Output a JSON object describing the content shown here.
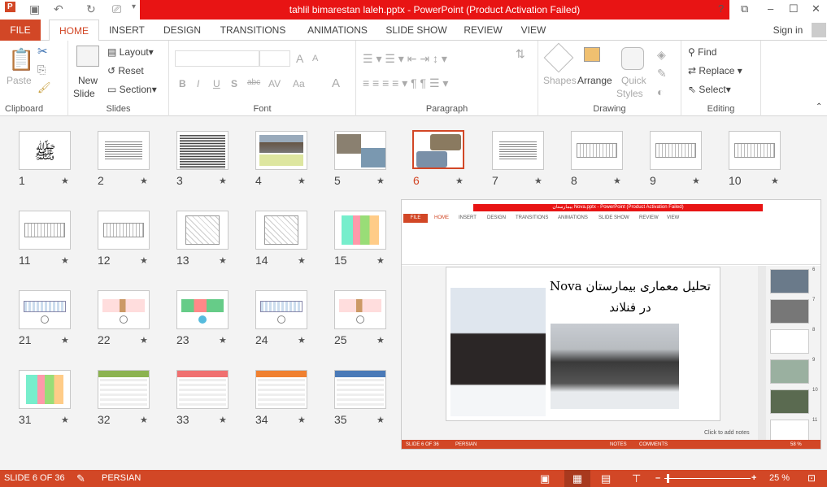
{
  "window": {
    "title": "tahlil bimarestan laleh.pptx -  PowerPoint (Product Activation Failed)",
    "help": "?",
    "restore_ribbon": "⧉",
    "minimize": "–",
    "maximize": "☐",
    "close": "✕"
  },
  "qat": {
    "app_icon": "powerpoint-icon",
    "save": "💾",
    "undo": "↶",
    "redo": "↻",
    "present": "⎚",
    "customize": "▾"
  },
  "tabs": [
    {
      "label": "FILE"
    },
    {
      "label": "HOME"
    },
    {
      "label": "INSERT"
    },
    {
      "label": "DESIGN"
    },
    {
      "label": "TRANSITIONS"
    },
    {
      "label": "ANIMATIONS"
    },
    {
      "label": "SLIDE SHOW"
    },
    {
      "label": "REVIEW"
    },
    {
      "label": "VIEW"
    }
  ],
  "sign_in": "Sign in",
  "ribbon": {
    "clipboard": {
      "label": "Clipboard",
      "paste": "Paste"
    },
    "slides": {
      "label": "Slides",
      "new_slide": "New",
      "new_slide2": "Slide",
      "layout": "Layout",
      "reset": "Reset",
      "section": "Section"
    },
    "font": {
      "label": "Font",
      "bold": "B",
      "italic": "I",
      "underline": "U",
      "shadow": "S",
      "strike": "abc",
      "spacing": "AV",
      "case": "Aa",
      "color": "A",
      "grow": "A",
      "shrink": "A"
    },
    "paragraph": {
      "label": "Paragraph"
    },
    "drawing": {
      "label": "Drawing",
      "shapes": "Shapes",
      "arrange": "Arrange",
      "quick_styles": "Quick",
      "quick_styles2": "Styles"
    },
    "editing": {
      "label": "Editing",
      "find": "Find",
      "replace": "Replace",
      "select": "Select"
    }
  },
  "slides": [
    {
      "n": "1",
      "kind": "calligraphy"
    },
    {
      "n": "2",
      "kind": "text"
    },
    {
      "n": "3",
      "kind": "densetext"
    },
    {
      "n": "4",
      "kind": "photo"
    },
    {
      "n": "5",
      "kind": "photos"
    },
    {
      "n": "6",
      "kind": "photos2",
      "selected": true
    },
    {
      "n": "7",
      "kind": "text"
    },
    {
      "n": "8",
      "kind": "drawing"
    },
    {
      "n": "9",
      "kind": "drawing"
    },
    {
      "n": "10",
      "kind": "drawing"
    },
    {
      "n": "11",
      "kind": "drawing"
    },
    {
      "n": "12",
      "kind": "drawing"
    },
    {
      "n": "13",
      "kind": "plan"
    },
    {
      "n": "14",
      "kind": "plan"
    },
    {
      "n": "15",
      "kind": "plancolor"
    },
    {
      "n": "21",
      "kind": "elev"
    },
    {
      "n": "22",
      "kind": "elevcolor"
    },
    {
      "n": "23",
      "kind": "elevgreen"
    },
    {
      "n": "24",
      "kind": "elev"
    },
    {
      "n": "25",
      "kind": "elevcolor"
    },
    {
      "n": "31",
      "kind": "plancolor"
    },
    {
      "n": "32",
      "kind": "table",
      "color": "#8cb350"
    },
    {
      "n": "33",
      "kind": "table",
      "color": "#f07070"
    },
    {
      "n": "34",
      "kind": "table",
      "color": "#f08030"
    },
    {
      "n": "35",
      "kind": "table",
      "color": "#4a7ab8"
    }
  ],
  "overlay": {
    "title": "بیمارستان Nova.pptx  -  PowerPoint (Product Activation Failed)",
    "tabs": [
      "FILE",
      "HOME",
      "INSERT",
      "DESIGN",
      "TRANSITIONS",
      "ANIMATIONS",
      "SLIDE SHOW",
      "REVIEW",
      "VIEW"
    ],
    "slide_title_line1": "تحلیل معماری بیمارستان Nova",
    "slide_title_line2": "در فنلاند",
    "notes_hint": "Click to add notes",
    "side_numbers": [
      "6",
      "7",
      "8",
      "9",
      "10",
      "11"
    ],
    "status_left": "SLIDE 6 OF 36",
    "status_lang": "PERSIAN",
    "notes": "NOTES",
    "comments": "COMMENTS",
    "zoom": "58 %"
  },
  "status": {
    "slide_of": "SLIDE 6 OF 36",
    "language": "PERSIAN",
    "zoom": "25 %",
    "zoom_level_percent": 25
  }
}
